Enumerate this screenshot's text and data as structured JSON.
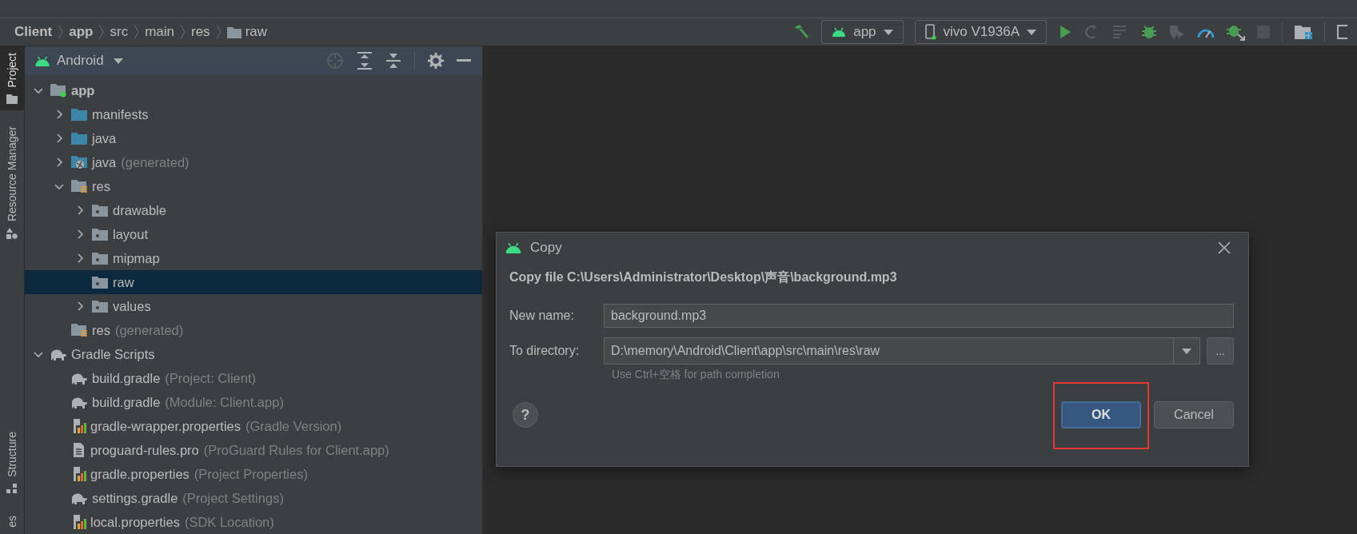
{
  "breadcrumbs": [
    {
      "label": "Client",
      "kind": "bold"
    },
    {
      "label": "app",
      "kind": "bold"
    },
    {
      "label": "src",
      "kind": "plain"
    },
    {
      "label": "main",
      "kind": "plain"
    },
    {
      "label": "res",
      "kind": "plain"
    },
    {
      "label": "raw",
      "kind": "folder"
    }
  ],
  "run_config": {
    "label": "app"
  },
  "device": {
    "label": "vivo V1936A"
  },
  "side_tabs_top": [
    {
      "label": "Project",
      "selected": true
    },
    {
      "label": "Resource Manager",
      "selected": false
    }
  ],
  "side_tabs_bottom": [
    {
      "label": "Structure",
      "selected": false
    },
    {
      "label": "es",
      "selected": false
    }
  ],
  "project_panel": {
    "view": "Android"
  },
  "tree": [
    {
      "label": "app",
      "kind": "module",
      "bold": true,
      "expanded": true,
      "selected": false,
      "children": [
        {
          "label": "manifests",
          "kind": "folder-blue",
          "expanded": false,
          "selected": false
        },
        {
          "label": "java",
          "kind": "folder-blue",
          "expanded": false,
          "selected": false
        },
        {
          "label": "java",
          "note": "(generated)",
          "kind": "folder-generated",
          "expanded": false,
          "selected": false
        },
        {
          "label": "res",
          "kind": "res",
          "expanded": true,
          "selected": false,
          "children": [
            {
              "label": "drawable",
              "kind": "res-dir",
              "expanded": false,
              "selected": false
            },
            {
              "label": "layout",
              "kind": "res-dir",
              "expanded": false,
              "selected": false
            },
            {
              "label": "mipmap",
              "kind": "res-dir",
              "expanded": false,
              "selected": false
            },
            {
              "label": "raw",
              "kind": "res-dir",
              "selected": true
            },
            {
              "label": "values",
              "kind": "res-dir",
              "expanded": false,
              "selected": false
            }
          ]
        },
        {
          "label": "res",
          "note": "(generated)",
          "kind": "res",
          "selected": false
        }
      ]
    },
    {
      "label": "Gradle Scripts",
      "kind": "gradle",
      "expanded": true,
      "selected": false,
      "children": [
        {
          "label": "build.gradle",
          "note": "(Project: Client)",
          "kind": "gradle",
          "selected": false
        },
        {
          "label": "build.gradle",
          "note": "(Module: Client.app)",
          "kind": "gradle",
          "selected": false
        },
        {
          "label": "gradle-wrapper.properties",
          "note": "(Gradle Version)",
          "kind": "props",
          "selected": false
        },
        {
          "label": "proguard-rules.pro",
          "note": "(ProGuard Rules for Client.app)",
          "kind": "file",
          "selected": false
        },
        {
          "label": "gradle.properties",
          "note": "(Project Properties)",
          "kind": "props",
          "selected": false
        },
        {
          "label": "settings.gradle",
          "note": "(Project Settings)",
          "kind": "gradle",
          "selected": false
        },
        {
          "label": "local.properties",
          "note": "(SDK Location)",
          "kind": "props",
          "selected": false
        }
      ]
    }
  ],
  "dialog": {
    "title": "Copy",
    "message": "Copy file C:\\Users\\Administrator\\Desktop\\声音\\background.mp3",
    "fields": [
      {
        "label": "New name:",
        "value": "background.mp3",
        "kind": "text"
      },
      {
        "label": "To directory:",
        "value": "D:\\memory\\Android\\Client\\app\\src\\main\\res\\raw",
        "kind": "combo",
        "browse": "..."
      }
    ],
    "hint": "Use Ctrl+空格 for path completion",
    "help": "?",
    "buttons": [
      {
        "label": "OK",
        "default": true,
        "highlighted": true
      },
      {
        "label": "Cancel",
        "default": false,
        "highlighted": false
      }
    ]
  }
}
